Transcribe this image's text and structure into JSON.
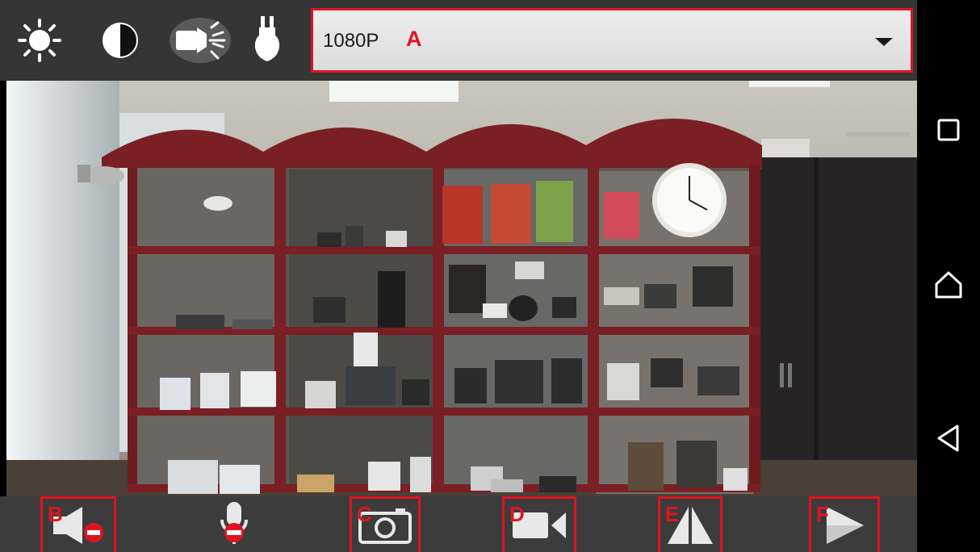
{
  "top_toolbar": {
    "icons": [
      "brightness-icon",
      "contrast-icon",
      "ir-light-icon",
      "bulb-icon"
    ],
    "resolution_select": {
      "value": "1080P",
      "marker": "A"
    }
  },
  "bottom_toolbar": {
    "buttons": [
      {
        "name": "speaker-mute-button",
        "icon": "speaker-muted-icon",
        "marker": "B"
      },
      {
        "name": "microphone-button",
        "icon": "microphone-muted-icon",
        "marker": ""
      },
      {
        "name": "snapshot-button",
        "icon": "camera-icon",
        "marker": "C"
      },
      {
        "name": "record-button",
        "icon": "video-camera-icon",
        "marker": "D"
      },
      {
        "name": "flip-button",
        "icon": "mirror-flip-icon",
        "marker": "E"
      },
      {
        "name": "play-button",
        "icon": "play-icon",
        "marker": "F"
      }
    ]
  },
  "android_nav": {
    "icons": [
      "recents-icon",
      "home-icon",
      "back-icon"
    ]
  },
  "colors": {
    "highlight": "#e0141f",
    "toolbar": "#353535",
    "shelf": "#7a1f24"
  }
}
